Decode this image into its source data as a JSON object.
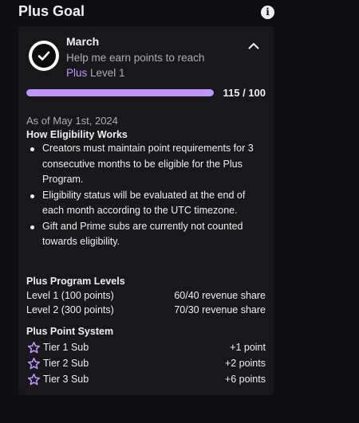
{
  "header": {
    "title": "Plus Goal",
    "info_icon": "info-icon"
  },
  "goal": {
    "month": "March",
    "description_line1": "Help me earn points to reach",
    "plus_label": "Plus",
    "level_label": " Level 1",
    "progress_current": 115,
    "progress_target": 100,
    "progress_text": "115 / 100",
    "badge_icon": "checkmark-badge-icon",
    "collapse_icon": "chevron-up-icon"
  },
  "eligibility": {
    "as_of": "As of May 1st, 2024",
    "title": "How Eligibility Works",
    "bullets": [
      "Creators must maintain point requirements for 3 consecutive months to be eligible for the Plus Program.",
      "Eligibility status will be evaluated at the end of each month according to the UTC timezone.",
      "Gift and Prime subs are currently not counted towards eligibility."
    ]
  },
  "levels": {
    "title": "Plus Program Levels",
    "rows": [
      {
        "label": "Level 1 (100 points)",
        "value": "60/40 revenue share"
      },
      {
        "label": "Level 2 (300 points)",
        "value": "70/30 revenue share"
      }
    ]
  },
  "points": {
    "title": "Plus Point System",
    "tier_icon": "star-icon",
    "rows": [
      {
        "label": "Tier 1 Sub",
        "value": "+1 point"
      },
      {
        "label": "Tier 2 Sub",
        "value": "+2 points"
      },
      {
        "label": "Tier 3 Sub",
        "value": "+6 points"
      }
    ]
  },
  "colors": {
    "accent": "#bf94ff",
    "background": "#0e0e10",
    "card": "#18181b",
    "text_primary": "#efeff1",
    "text_secondary": "#adadb8"
  }
}
